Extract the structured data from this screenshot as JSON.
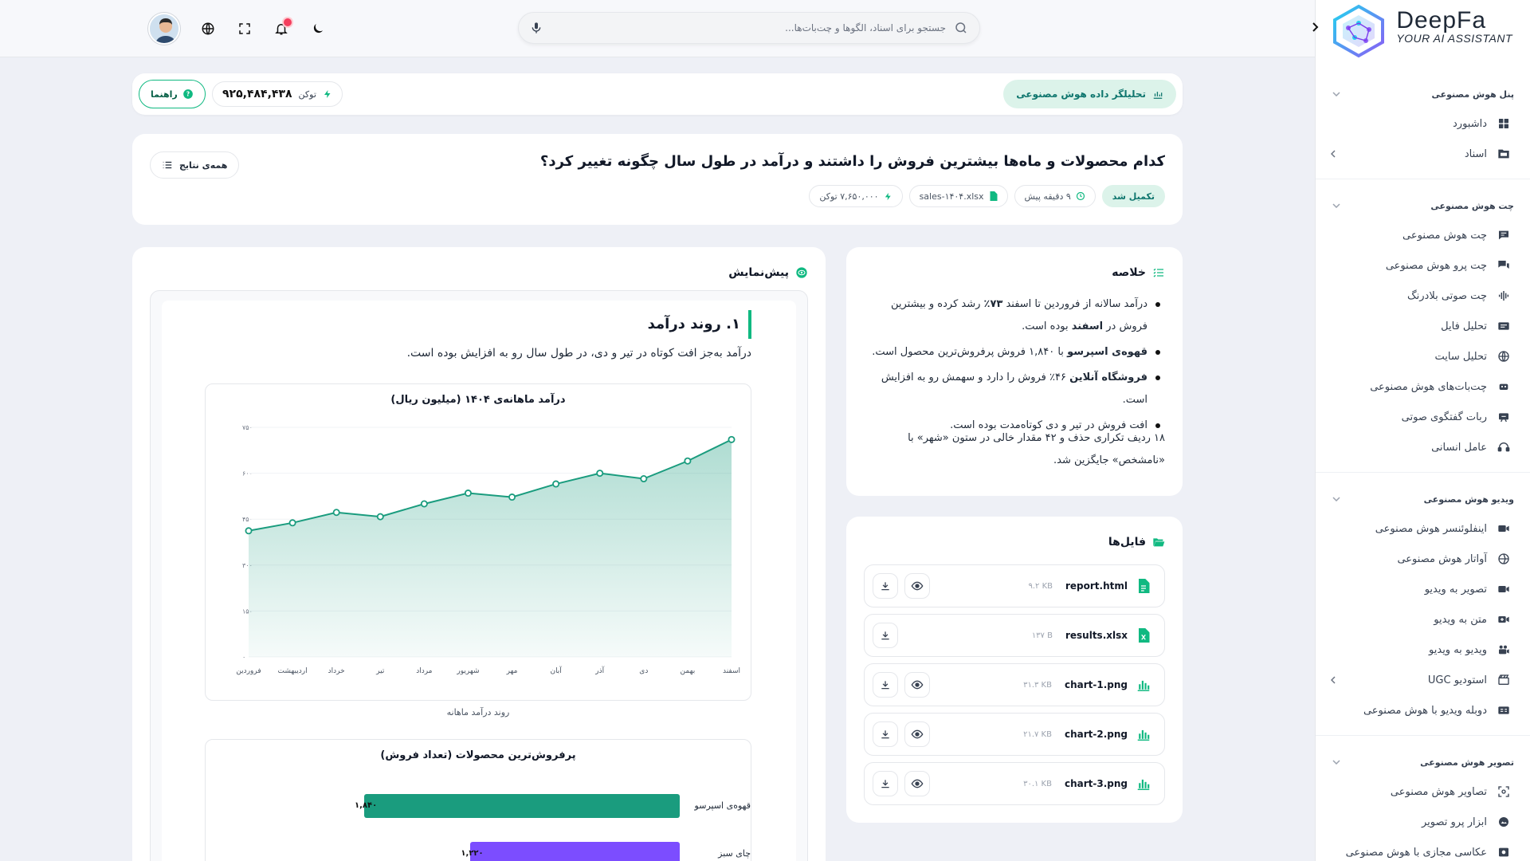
{
  "brand": {
    "name": "DeepFa",
    "tagline": "YOUR AI ASSISTANT"
  },
  "search": {
    "placeholder": "جستجو برای اسناد، الگوها و چت‌بات‌ها..."
  },
  "header": {
    "analyst_label": "تحلیلگر داده هوش مصنوعی",
    "token_label": "توکن",
    "token_value": "۹۲۵,۴۸۴,۴۳۸",
    "guide_label": "راهنما"
  },
  "question": {
    "title": "کدام محصولات و ماه‌ها بیشترین فروش را داشتند و درآمد در طول سال چگونه تغییر کرد؟",
    "status": "تکمیل شد",
    "time": "۹ دقیقه پیش",
    "file": "sales-۱۴۰۴.xlsx",
    "tokens": "۷,۶۵۰,۰۰۰ توکن",
    "all_results": "همه‌ی نتایج"
  },
  "summary": {
    "title": "خلاصه",
    "bullets": [
      {
        "pre": "درآمد سالانه از فروردین تا اسفند ",
        "b1": "۷۳٪",
        "mid": " رشد کرده و بیشترین فروش در ",
        "b2": "اسفند",
        "post": " بوده است."
      },
      {
        "pre": "",
        "b1": "قهوه‌ی اسپرسو",
        "mid": " با ۱,۸۴۰ فروش پرفروش‌ترین محصول است.",
        "b2": "",
        "post": ""
      },
      {
        "pre": "",
        "b1": "فروشگاه آنلاین",
        "mid": " ۴۶٪ فروش را دارد و سهمش رو به افزایش است.",
        "b2": "",
        "post": ""
      },
      {
        "pre": "افت فروش در تیر و دی کوتاه‌مدت بوده است.",
        "b1": "",
        "mid": "",
        "b2": "",
        "post": ""
      }
    ],
    "note": "۱۸ ردیف تکراری حذف و ۴۲ مقدار خالی در ستون «شهر» با «نامشخص» جایگزین شد."
  },
  "files": {
    "title": "فایل‌ها",
    "items": [
      {
        "name": "report.html",
        "size": "۹.۲ KB",
        "icon": "file-doc-icon",
        "preview": true
      },
      {
        "name": "results.xlsx",
        "size": "۱۳۷ B",
        "icon": "file-excel-icon",
        "preview": false
      },
      {
        "name": "chart-1.png",
        "size": "۳۱.۳ KB",
        "icon": "chart-icon",
        "preview": true
      },
      {
        "name": "chart-2.png",
        "size": "۲۱.۷ KB",
        "icon": "chart-icon",
        "preview": true
      },
      {
        "name": "chart-3.png",
        "size": "۳۰.۱ KB",
        "icon": "chart-icon",
        "preview": true
      }
    ]
  },
  "preview": {
    "title": "پیش‌نمایش",
    "section_heading": "۱. روند درآمد",
    "section_text": "درآمد به‌جز افت کوتاه در تیر و دی، در طول سال رو به افزایش بوده است.",
    "chart_caption": "روند درآمد ماهانه"
  },
  "chart_data": [
    {
      "type": "area",
      "title": "درآمد ماهانه‌ی ۱۴۰۴ (میلیون ریال)",
      "categories": [
        "فروردین",
        "اردیبهشت",
        "خرداد",
        "تیر",
        "مرداد",
        "شهریور",
        "مهر",
        "آبان",
        "آذر",
        "دی",
        "بهمن",
        "اسفند"
      ],
      "values": [
        412,
        438,
        472,
        458,
        500,
        535,
        522,
        565,
        600,
        582,
        640,
        710
      ],
      "yticks": [
        "۰",
        "۱۵۰",
        "۳۰۰",
        "۴۵۰",
        "۶۰۰",
        "۷۵۰"
      ],
      "ylim": [
        0,
        750
      ],
      "color": "#1a9c7e"
    },
    {
      "type": "bar",
      "title": "پرفروش‌ترین محصولات (تعداد فروش)",
      "categories": [
        "قهوه‌ی اسپرسو",
        "چای سبز"
      ],
      "value_labels": [
        "۱,۸۴۰",
        "۱,۲۲۰"
      ],
      "values": [
        1840,
        1220
      ],
      "xlim": [
        0,
        1840
      ],
      "colors": [
        "#1a9c7e",
        "#7c4dff"
      ]
    }
  ],
  "sidebar": {
    "sections": [
      {
        "title": "پنل هوش مصنوعی",
        "items": [
          {
            "label": "داشبورد",
            "icon": "dashboard-icon"
          },
          {
            "label": "اسناد",
            "icon": "folder-icon",
            "more": true
          }
        ]
      },
      {
        "title": "چت هوش مصنوعی",
        "items": [
          {
            "label": "چت هوش مصنوعی",
            "icon": "chat-icon"
          },
          {
            "label": "چت پرو هوش مصنوعی",
            "icon": "chat-pro-icon"
          },
          {
            "label": "چت صوتی بلادرنگ",
            "icon": "voice-wave-icon"
          },
          {
            "label": "تحلیل فایل",
            "icon": "file-analysis-icon"
          },
          {
            "label": "تحلیل سایت",
            "icon": "globe-icon"
          },
          {
            "label": "چت‌بات‌های هوش مصنوعی",
            "icon": "bot-icon"
          },
          {
            "label": "ربات گفتگوی صوتی",
            "icon": "voice-bot-icon"
          },
          {
            "label": "عامل انسانی",
            "icon": "agent-icon"
          }
        ]
      },
      {
        "title": "ویدیو هوش مصنوعی",
        "items": [
          {
            "label": "اینفلوئنسر هوش مصنوعی",
            "icon": "video-icon"
          },
          {
            "label": "آواتار هوش مصنوعی",
            "icon": "avatar-icon"
          },
          {
            "label": "تصویر به ویدیو",
            "icon": "video-icon"
          },
          {
            "label": "متن به ویدیو",
            "icon": "video-plus-icon"
          },
          {
            "label": "ویدیو به ویدیو",
            "icon": "video-swap-icon"
          },
          {
            "label": "استودیو UGC",
            "icon": "studio-icon",
            "more": true
          },
          {
            "label": "دوبله ویدیو با هوش مصنوعی",
            "icon": "dub-icon"
          }
        ]
      },
      {
        "title": "تصویر هوش مصنوعی",
        "items": [
          {
            "label": "تصاویر هوش مصنوعی",
            "icon": "image-icon"
          },
          {
            "label": "ابزار پرو تصویر",
            "icon": "image-pro-icon"
          },
          {
            "label": "عکاسی مجازی با هوش مصنوعی",
            "icon": "camera-icon"
          }
        ]
      }
    ]
  }
}
